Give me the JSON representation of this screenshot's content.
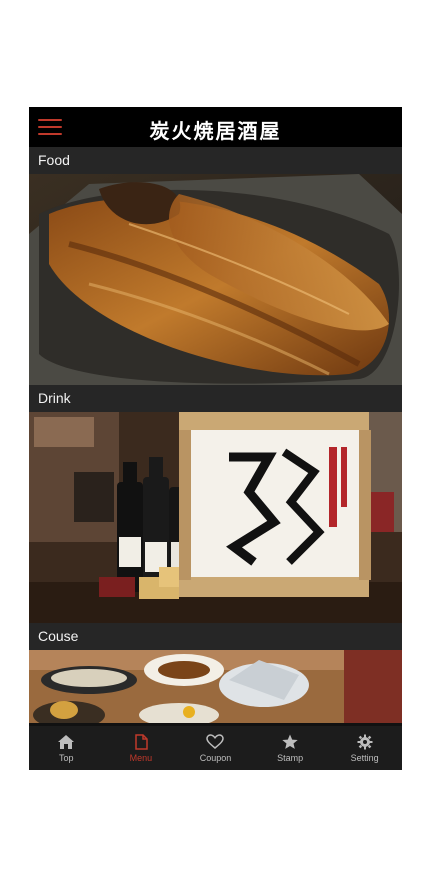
{
  "app": {
    "title": "炭火焼居酒屋"
  },
  "colors": {
    "accent": "#c0392b",
    "header_bg": "#000000",
    "section_header_bg": "#262626",
    "tabbar_bg": "#1c1c1c"
  },
  "sections": [
    {
      "label": "Food",
      "image": "grilled-fish-photo"
    },
    {
      "label": "Drink",
      "image": "sake-barrel-photo"
    },
    {
      "label": "Couse",
      "image": "course-meal-photo"
    }
  ],
  "tabbar": {
    "items": [
      {
        "label": "Top",
        "icon": "home-icon",
        "active": false
      },
      {
        "label": "Menu",
        "icon": "menu-page-icon",
        "active": true
      },
      {
        "label": "Coupon",
        "icon": "heart-icon",
        "active": false
      },
      {
        "label": "Stamp",
        "icon": "star-icon",
        "active": false
      },
      {
        "label": "Setting",
        "icon": "gear-icon",
        "active": false
      }
    ]
  }
}
